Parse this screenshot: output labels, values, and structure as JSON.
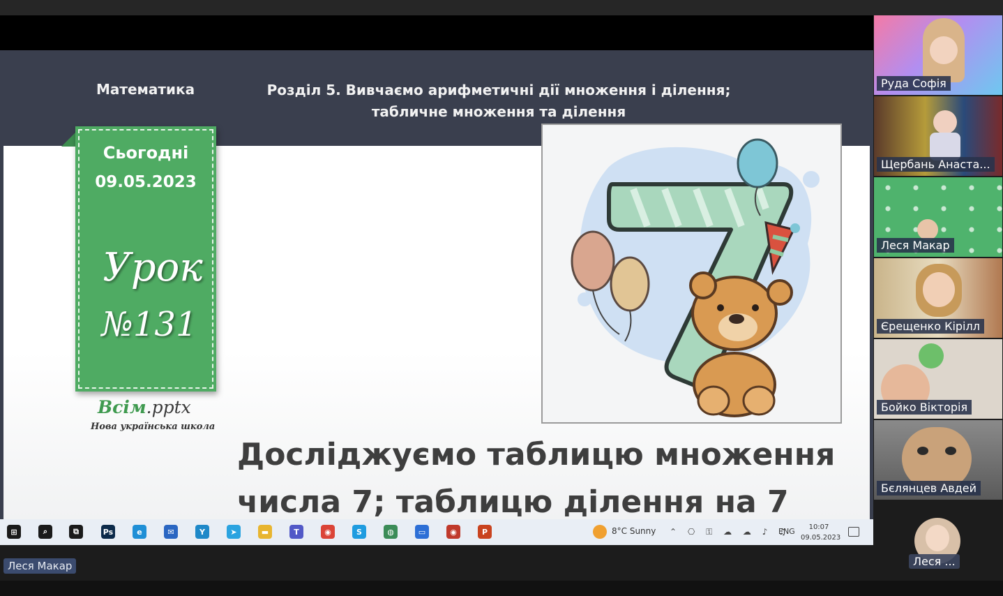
{
  "slide": {
    "subject": "Математика",
    "section_line1": "Розділ 5. Вивчаємо арифметичні дії множення і ділення;",
    "section_line2": "табличне множення та ділення",
    "card": {
      "today": "Сьогодні",
      "date": "09.05.2023",
      "lesson": "Урок",
      "number": "№131"
    },
    "brand": {
      "name_green": "Всім",
      "name_dark": ".pptx",
      "subtitle": "Нова українська школа"
    },
    "title_line1": "Досліджуємо таблицю множення",
    "title_line2": "числа 7; таблицю ділення на 7"
  },
  "taskbar": {
    "icons": [
      {
        "name": "windows-start-icon",
        "glyph": "⊞",
        "color": "#1a1a1a"
      },
      {
        "name": "search-icon",
        "glyph": "⌕",
        "color": "#1a1a1a"
      },
      {
        "name": "task-view-icon",
        "glyph": "⧉",
        "color": "#1a1a1a"
      },
      {
        "name": "photoshop-icon",
        "glyph": "Ps",
        "color": "#0c2a4a"
      },
      {
        "name": "edge-icon",
        "glyph": "e",
        "color": "#1f8fd6"
      },
      {
        "name": "mail-icon",
        "glyph": "✉",
        "color": "#2a66c2"
      },
      {
        "name": "app-arrow-icon",
        "glyph": "Y",
        "color": "#1e88c8"
      },
      {
        "name": "telegram-icon",
        "glyph": "➤",
        "color": "#2aa3e0"
      },
      {
        "name": "file-explorer-icon",
        "glyph": "▬",
        "color": "#e8b530"
      },
      {
        "name": "teams-icon",
        "glyph": "T",
        "color": "#5259c7"
      },
      {
        "name": "chrome-icon",
        "glyph": "◉",
        "color": "#db4437"
      },
      {
        "name": "skype-icon",
        "glyph": "S",
        "color": "#1f9ce0"
      },
      {
        "name": "globe-icon",
        "glyph": "◍",
        "color": "#3b8c58"
      },
      {
        "name": "zoom-icon",
        "glyph": "▭",
        "color": "#2d6fd6"
      },
      {
        "name": "chrome-profile-icon",
        "glyph": "◉",
        "color": "#c0392b"
      },
      {
        "name": "powerpoint-icon",
        "glyph": "P",
        "color": "#c9431f"
      }
    ],
    "weather": "8°C  Sunny",
    "tray_icons": "⌃ ⎔ ⚿ ☁ ☁ ♪ ♫",
    "language": "ENG",
    "time": "10:07",
    "date": "09.05.2023"
  },
  "presenter_name": "Леся Макар",
  "participants": [
    {
      "name": "Руда Софія"
    },
    {
      "name": "Щербань Анаста..."
    },
    {
      "name": "Леся Макар"
    },
    {
      "name": "Єрещенко Кірілл"
    },
    {
      "name": "Бойко Вікторія"
    },
    {
      "name": "Бєлянцев Авдей"
    }
  ],
  "self_view": {
    "name": "Леся ..."
  }
}
